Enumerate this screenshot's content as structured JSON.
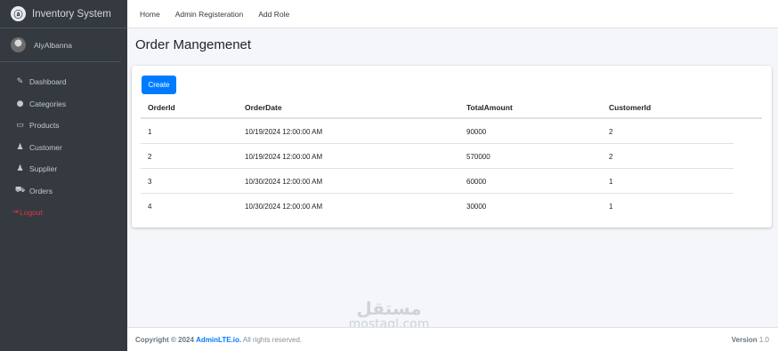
{
  "brand": {
    "name": "Inventory System"
  },
  "user": {
    "name": "AlyAlbanna"
  },
  "sidebar": {
    "items": [
      {
        "label": "Dashboard",
        "icon": "wrench-icon"
      },
      {
        "label": "Categories",
        "icon": "palette-icon"
      },
      {
        "label": "Products",
        "icon": "monitor-icon"
      },
      {
        "label": "Customer",
        "icon": "users-icon"
      },
      {
        "label": "Supplier",
        "icon": "users-icon"
      },
      {
        "label": "Orders",
        "icon": "truck-icon"
      }
    ],
    "logout": "Logout"
  },
  "topnav": [
    "Home",
    "Admin Registeration",
    "Add Role"
  ],
  "page": {
    "title": "Order Mangemenet"
  },
  "card": {
    "create_label": "Create"
  },
  "table": {
    "headers": [
      "OrderId",
      "OrderDate",
      "TotalAmount",
      "CustomerId"
    ],
    "rows": [
      [
        "1",
        "10/19/2024 12:00:00 AM",
        "90000",
        "2"
      ],
      [
        "2",
        "10/19/2024 12:00:00 AM",
        "570000",
        "2"
      ],
      [
        "3",
        "10/30/2024 12:00:00 AM",
        "60000",
        "1"
      ],
      [
        "4",
        "10/30/2024 12:00:00 AM",
        "30000",
        "1"
      ]
    ]
  },
  "footer": {
    "copyright_prefix": "Copyright © 2024",
    "brand_link": "AdminLTE.io.",
    "rights": "All rights reserved.",
    "version_label": "Version",
    "version_value": "1.0"
  },
  "watermark": {
    "arabic": "مستقل",
    "latin": "mostaql.com"
  },
  "colors": {
    "sidebar_bg": "#343a40",
    "primary": "#007bff",
    "danger": "#dc3545",
    "page_bg": "#f4f6f9"
  }
}
